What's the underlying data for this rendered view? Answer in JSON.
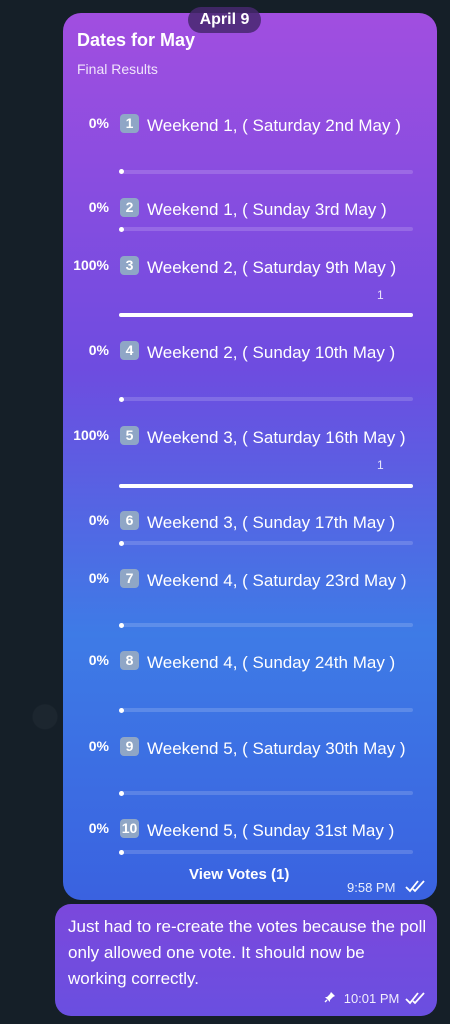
{
  "date_pill": "April 9",
  "poll": {
    "title": "Dates for May",
    "subtitle": "Final Results",
    "view_votes": "View Votes (1)",
    "time": "9:58 PM",
    "options": [
      {
        "pct": "0%",
        "num": "1",
        "label": "Weekend 1, ( Saturday 2nd May )",
        "fraction": 0
      },
      {
        "pct": "0%",
        "num": "2",
        "label": "Weekend 1, ( Sunday 3rd May )",
        "fraction": 0
      },
      {
        "pct": "100%",
        "num": "3",
        "label": "Weekend 2, ( Saturday 9th May )",
        "fraction": 1,
        "count": "1"
      },
      {
        "pct": "0%",
        "num": "4",
        "label": "Weekend 2, ( Sunday 10th May )",
        "fraction": 0
      },
      {
        "pct": "100%",
        "num": "5",
        "label": "Weekend 3, ( Saturday 16th May )",
        "fraction": 1,
        "count": "1"
      },
      {
        "pct": "0%",
        "num": "6",
        "label": "Weekend 3, ( Sunday 17th May )",
        "fraction": 0
      },
      {
        "pct": "0%",
        "num": "7",
        "label": "Weekend 4, ( Saturday 23rd May )",
        "fraction": 0
      },
      {
        "pct": "0%",
        "num": "8",
        "label": "Weekend 4, ( Sunday 24th May )",
        "fraction": 0
      },
      {
        "pct": "0%",
        "num": "9",
        "label": "Weekend 5, ( Saturday 30th May )",
        "fraction": 0
      },
      {
        "pct": "0%",
        "num": "10",
        "label": "Weekend 5, ( Sunday 31st May )",
        "fraction": 0
      }
    ]
  },
  "message": {
    "text": "Just had to re-create the votes because the poll only allowed one vote. It should now be working correctly.",
    "time": "10:01 PM",
    "pin_icon": "pin-icon",
    "ticks_icon": "double-check-icon"
  }
}
